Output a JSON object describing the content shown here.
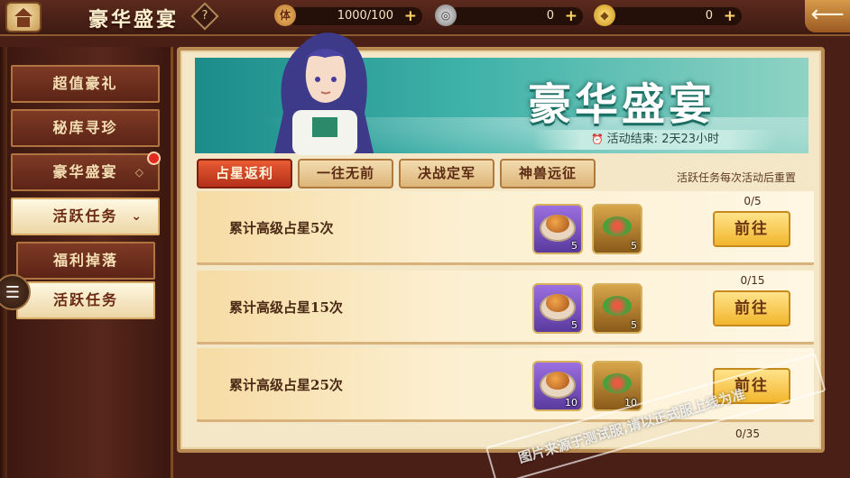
{
  "header": {
    "title": "豪华盛宴",
    "help_label": "?",
    "resources": [
      {
        "icon": "stamina-icon",
        "icon_text": "体",
        "value": "1000/100"
      },
      {
        "icon": "silver-coin-icon",
        "icon_text": "",
        "value": "0"
      },
      {
        "icon": "gold-ingot-icon",
        "icon_text": "",
        "value": "0"
      }
    ],
    "plus_label": "+",
    "back_label": "⟵"
  },
  "sidebar": {
    "items": [
      {
        "label": "超值豪礼"
      },
      {
        "label": "秘库寻珍"
      },
      {
        "label": "豪华盛宴"
      },
      {
        "label": "活跃任务"
      },
      {
        "label": "福利掉落"
      },
      {
        "label": "活跃任务"
      }
    ]
  },
  "banner": {
    "title": "豪华盛宴",
    "time_prefix": "活动结束:",
    "time_remaining": "2天23小时"
  },
  "tabs": [
    {
      "label": "占星返利",
      "active": true
    },
    {
      "label": "一往无前",
      "active": false
    },
    {
      "label": "决战定军",
      "active": false
    },
    {
      "label": "神兽远征",
      "active": false
    }
  ],
  "hint": "活跃任务每次活动后重置",
  "tasks": [
    {
      "desc": "累计高级占星5次",
      "progress": "0/5",
      "rewards": [
        {
          "icon": "roast-chicken-icon",
          "count": "5"
        },
        {
          "icon": "salad-icon",
          "count": "5"
        }
      ],
      "button": "前往"
    },
    {
      "desc": "累计高级占星15次",
      "progress": "0/15",
      "rewards": [
        {
          "icon": "roast-chicken-icon",
          "count": "5"
        },
        {
          "icon": "salad-icon",
          "count": "5"
        }
      ],
      "button": "前往"
    },
    {
      "desc": "累计高级占星25次",
      "progress": "",
      "rewards": [
        {
          "icon": "roast-chicken-icon",
          "count": "10"
        },
        {
          "icon": "salad-icon",
          "count": "10"
        }
      ],
      "button": "前往"
    }
  ],
  "partial_progress": "0/35",
  "watermark": "图片来源于测试服,请以正式服上线为准",
  "colors": {
    "tab_active": "#d4462a",
    "button_gold": "#f2b62c",
    "banner_teal": "#2aa39c"
  }
}
